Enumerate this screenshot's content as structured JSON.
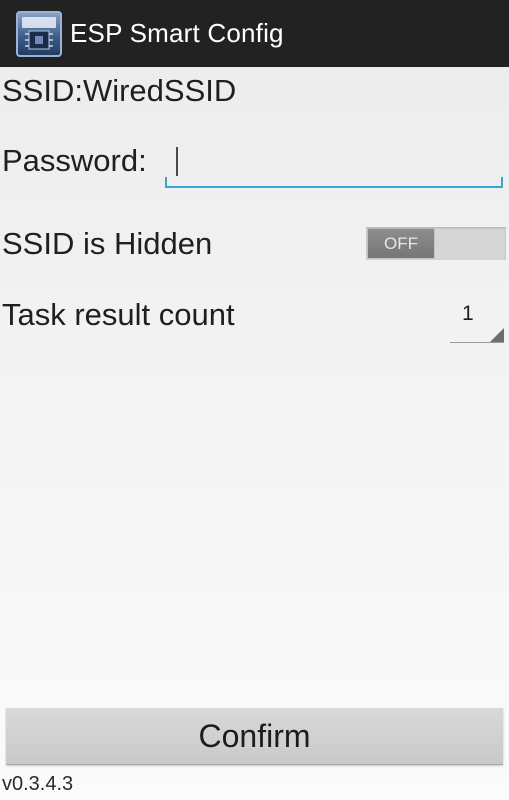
{
  "action_bar": {
    "title": "ESP Smart Config",
    "icon": "esp-app-icon"
  },
  "form": {
    "ssid_text": "SSID:WiredSSID",
    "password_label": "Password:",
    "password_value": "",
    "hidden_label": "SSID is Hidden",
    "hidden_toggle_state": "OFF",
    "task_count_label": "Task result count",
    "task_count_value": "1"
  },
  "confirm_label": "Confirm",
  "version": "v0.3.4.3",
  "colors": {
    "action_bar_bg": "#222222",
    "input_underline": "#3aa5d4",
    "button_bg": "#d1d1d1"
  }
}
